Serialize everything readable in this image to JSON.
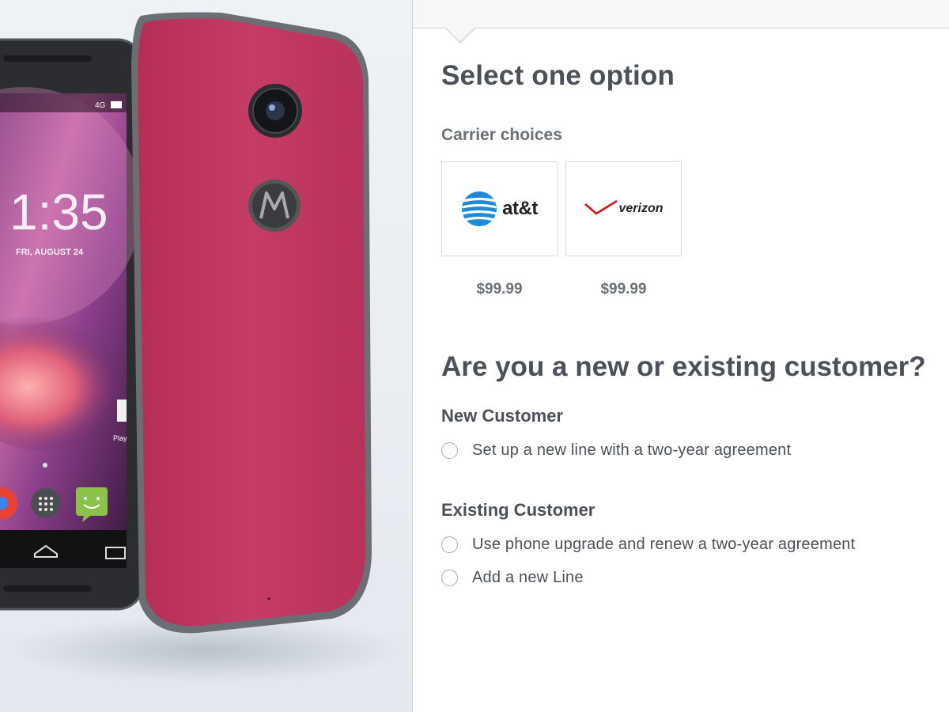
{
  "product": {
    "clock_time": "1:35",
    "clock_date": "FRI, AUGUST 24",
    "status_network": "4G",
    "back_color": "#c43a64",
    "app_label_partial": "Play"
  },
  "selection": {
    "title": "Select one option",
    "carrier_heading": "Carrier choices",
    "carriers": [
      {
        "logo_text": "at&t",
        "price": "$99.99",
        "brand_color": "#1f8bd6"
      },
      {
        "logo_text": "verizon",
        "price": "$99.99",
        "brand_color": "#d3141e"
      }
    ]
  },
  "customer": {
    "title": "Are you a new or existing customer?",
    "new_heading": "New Customer",
    "new_options": [
      {
        "label": "Set up a new line with a two-year agreement",
        "selected": false
      }
    ],
    "existing_heading": "Existing Customer",
    "existing_options": [
      {
        "label": "Use phone upgrade and renew a two-year agreement",
        "selected": false
      },
      {
        "label": "Add a new Line",
        "selected": false
      }
    ]
  }
}
